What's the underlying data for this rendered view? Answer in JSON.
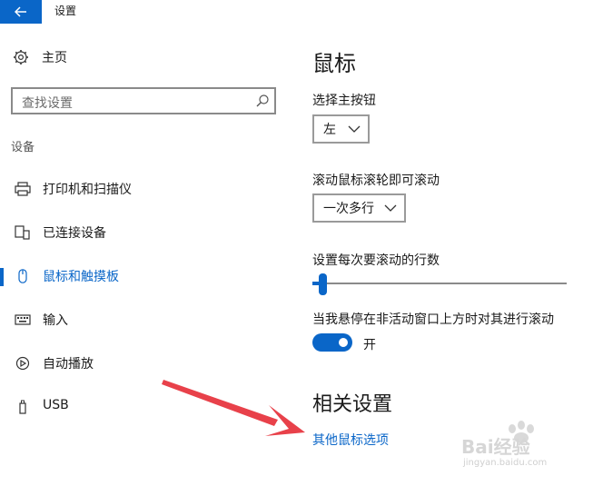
{
  "window": {
    "title": "设置"
  },
  "sidebar": {
    "home_label": "主页",
    "search_placeholder": "查找设置",
    "section_label": "设备",
    "items": [
      {
        "label": "打印机和扫描仪",
        "icon": "printer-icon"
      },
      {
        "label": "已连接设备",
        "icon": "devices-icon"
      },
      {
        "label": "鼠标和触摸板",
        "icon": "mouse-icon",
        "active": true
      },
      {
        "label": "输入",
        "icon": "keyboard-icon"
      },
      {
        "label": "自动播放",
        "icon": "autoplay-icon"
      },
      {
        "label": "USB",
        "icon": "usb-icon"
      }
    ]
  },
  "main": {
    "title": "鼠标",
    "primary_button_label": "选择主按钮",
    "primary_button_value": "左",
    "scroll_label": "滚动鼠标滚轮即可滚动",
    "scroll_value": "一次多行",
    "lines_label": "设置每次要滚动的行数",
    "lines_slider_level": 0.04,
    "inactive_scroll_label": "当我悬停在非活动窗口上方时对其进行滚动",
    "inactive_scroll_toggle": "开",
    "related_title": "相关设置",
    "other_mouse_options": "其他鼠标选项"
  },
  "watermark": {
    "line1": "Bai经验",
    "line2": "jingyan.baidu.com"
  },
  "colors": {
    "accent": "#0a66c8",
    "annotation_arrow": "#e8414a"
  }
}
